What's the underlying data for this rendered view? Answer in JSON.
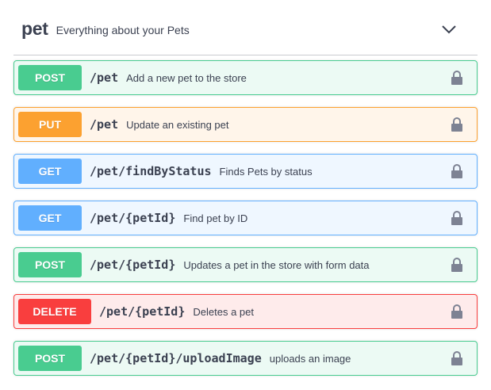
{
  "tag": {
    "name": "pet",
    "description": "Everything about your Pets",
    "expand_icon": "chevron-down-icon"
  },
  "operations": [
    {
      "method": "POST",
      "path": "/pet",
      "summary": "Add a new pet to the store",
      "color": "#49cc90",
      "icon": "lock-icon"
    },
    {
      "method": "PUT",
      "path": "/pet",
      "summary": "Update an existing pet",
      "color": "#fca130",
      "icon": "lock-icon"
    },
    {
      "method": "GET",
      "path": "/pet/findByStatus",
      "summary": "Finds Pets by status",
      "color": "#61affe",
      "icon": "lock-icon"
    },
    {
      "method": "GET",
      "path": "/pet/{petId}",
      "summary": "Find pet by ID",
      "color": "#61affe",
      "icon": "lock-icon"
    },
    {
      "method": "POST",
      "path": "/pet/{petId}",
      "summary": "Updates a pet in the store with form data",
      "color": "#49cc90",
      "icon": "lock-icon"
    },
    {
      "method": "DELETE",
      "path": "/pet/{petId}",
      "summary": "Deletes a pet",
      "color": "#f93e3e",
      "icon": "lock-icon"
    },
    {
      "method": "POST",
      "path": "/pet/{petId}/uploadImage",
      "summary": "uploads an image",
      "color": "#49cc90",
      "icon": "lock-icon"
    }
  ]
}
